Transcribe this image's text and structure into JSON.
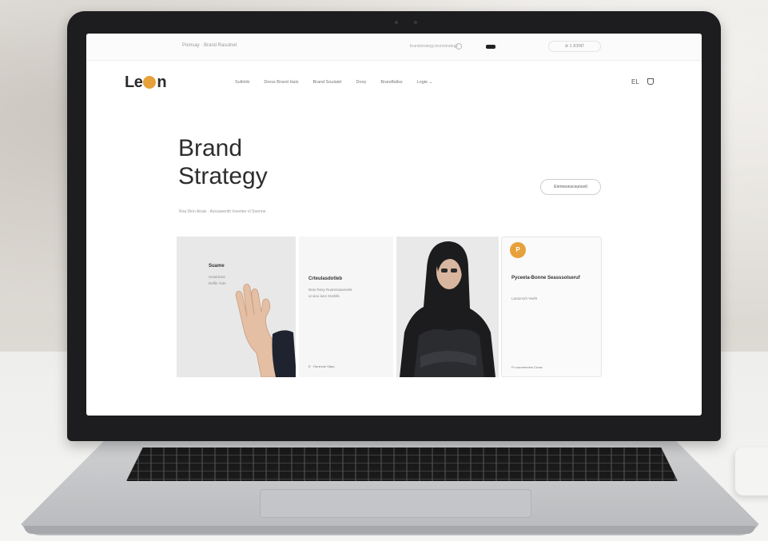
{
  "browser": {
    "tab_title": "Pomsay · Brand Rasulnet",
    "url": "brandstrategy.leon/strategy",
    "account_label": "⚙  1 JOINT"
  },
  "header": {
    "logo_text_left": "Le",
    "logo_text_right": "n",
    "nav_items": [
      "Sultimb",
      "Dress Brand Hals",
      "Brand Soulatel",
      "Dooy",
      "Brandfallss",
      "Logie ⌄"
    ],
    "right_label": "EL"
  },
  "hero": {
    "title_line1": "Brand",
    "title_line2": "Strategy",
    "subtitle": "Roa Dinn Anais · Asroawenth Inventer ol Soenne",
    "cta_label": "Enrmeonscouncetl"
  },
  "cards": [
    {
      "title": "Suame",
      "lines": [
        "Sotuldcais",
        "Delfin Yuts"
      ]
    },
    {
      "title": "Crteulasdotleb",
      "lines": [
        "Bras Resy Ruaressaamelst",
        "ut sieu lans Sneblls"
      ],
      "footer": "E · Reninnle Sttpa"
    },
    {
      "title": "",
      "lines": []
    },
    {
      "title": "Pyceeta-Bonne Seasssolseruf",
      "lines": [
        "Lantunsrit Yeeltt"
      ],
      "footer": "Fn ourneenrlns Curas",
      "badge": "P"
    }
  ],
  "colors": {
    "accent": "#e7a13a",
    "text": "#2d2d2d",
    "laptop_bezel": "#1d1d1f"
  }
}
